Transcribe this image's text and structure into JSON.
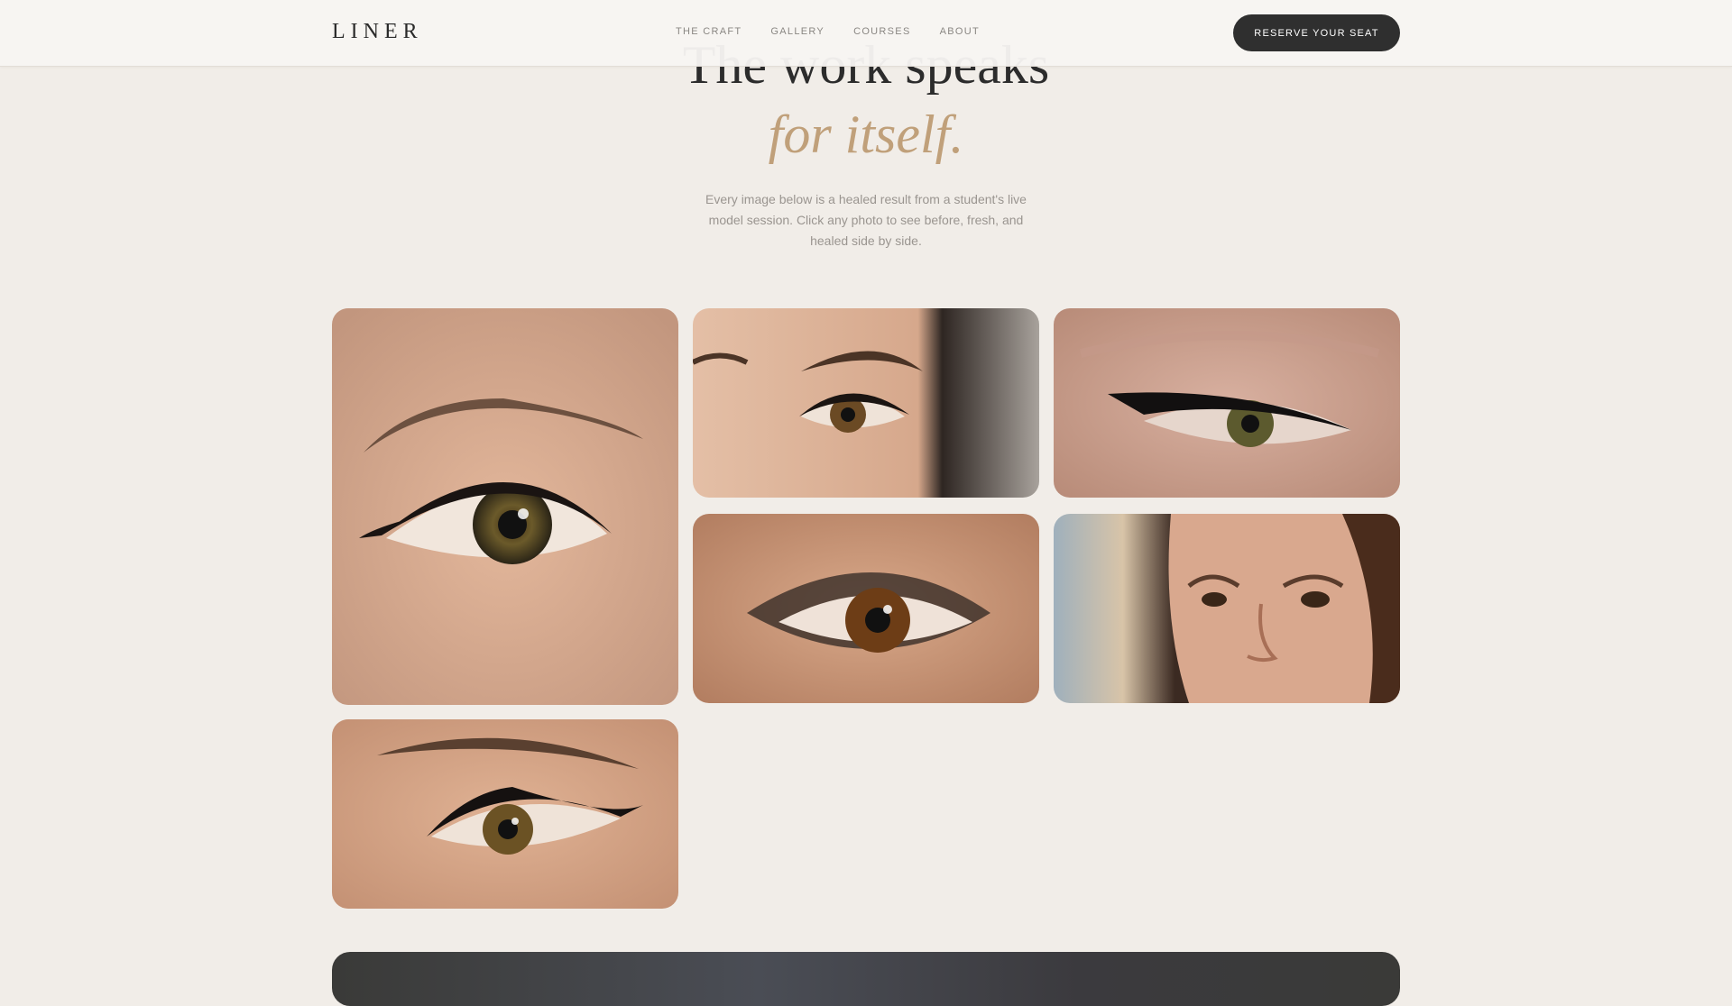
{
  "header": {
    "logo": "LINER",
    "nav": [
      {
        "label": "THE CRAFT"
      },
      {
        "label": "GALLERY"
      },
      {
        "label": "COURSES"
      },
      {
        "label": "ABOUT"
      }
    ],
    "cta_label": "RESERVE YOUR SEAT"
  },
  "hero": {
    "headline": "The work speaks",
    "headline_accent": "for itself.",
    "subtext": "Every image below is a healed result from a student's live model session. Click any photo to see before, fresh, and healed side by side."
  },
  "colors": {
    "background": "#f1ede8",
    "accent": "#c0a07a",
    "button": "#2f2f2f",
    "text_muted": "#9a9590"
  },
  "gallery": {
    "items": [
      {
        "subject": "winged-liner-eye-closeup"
      },
      {
        "subject": "natural-lash-eye"
      },
      {
        "subject": "winged-liner-mature-eye"
      },
      {
        "subject": "smoky-liner-brown-eye"
      },
      {
        "subject": "woman-face-portrait"
      },
      {
        "subject": "winged-liner-eye-with-brow"
      }
    ]
  }
}
